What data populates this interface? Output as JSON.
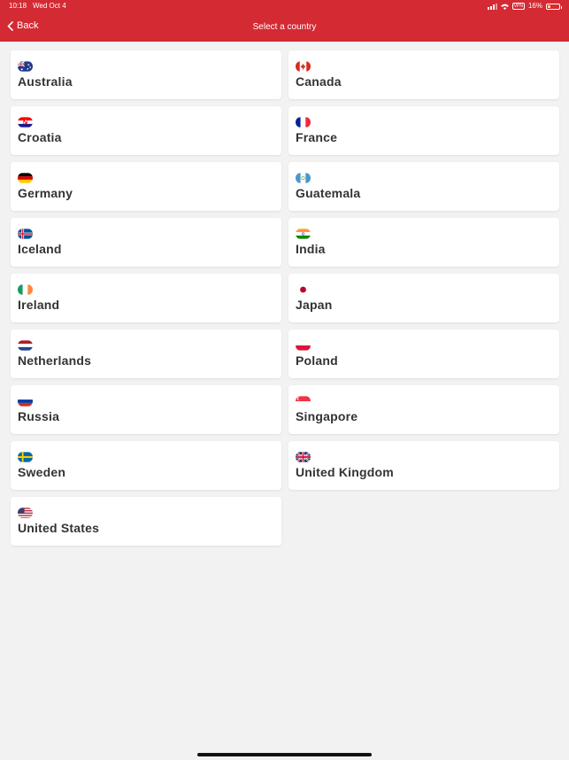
{
  "status": {
    "time": "10:18",
    "date": "Wed Oct 4",
    "battery": "16%",
    "vpn": "VPN"
  },
  "nav": {
    "back_label": "Back",
    "title": "Select a country"
  },
  "countries": [
    {
      "name": "Australia"
    },
    {
      "name": "Canada"
    },
    {
      "name": "Croatia"
    },
    {
      "name": "France"
    },
    {
      "name": "Germany"
    },
    {
      "name": "Guatemala"
    },
    {
      "name": "Iceland"
    },
    {
      "name": "India"
    },
    {
      "name": "Ireland"
    },
    {
      "name": "Japan"
    },
    {
      "name": "Netherlands"
    },
    {
      "name": "Poland"
    },
    {
      "name": "Russia"
    },
    {
      "name": "Singapore"
    },
    {
      "name": "Sweden"
    },
    {
      "name": "United Kingdom"
    },
    {
      "name": "United States"
    }
  ],
  "colors": {
    "header": "#d42a34",
    "background": "#f2f2f2",
    "tile": "#ffffff",
    "text": "#333333"
  }
}
